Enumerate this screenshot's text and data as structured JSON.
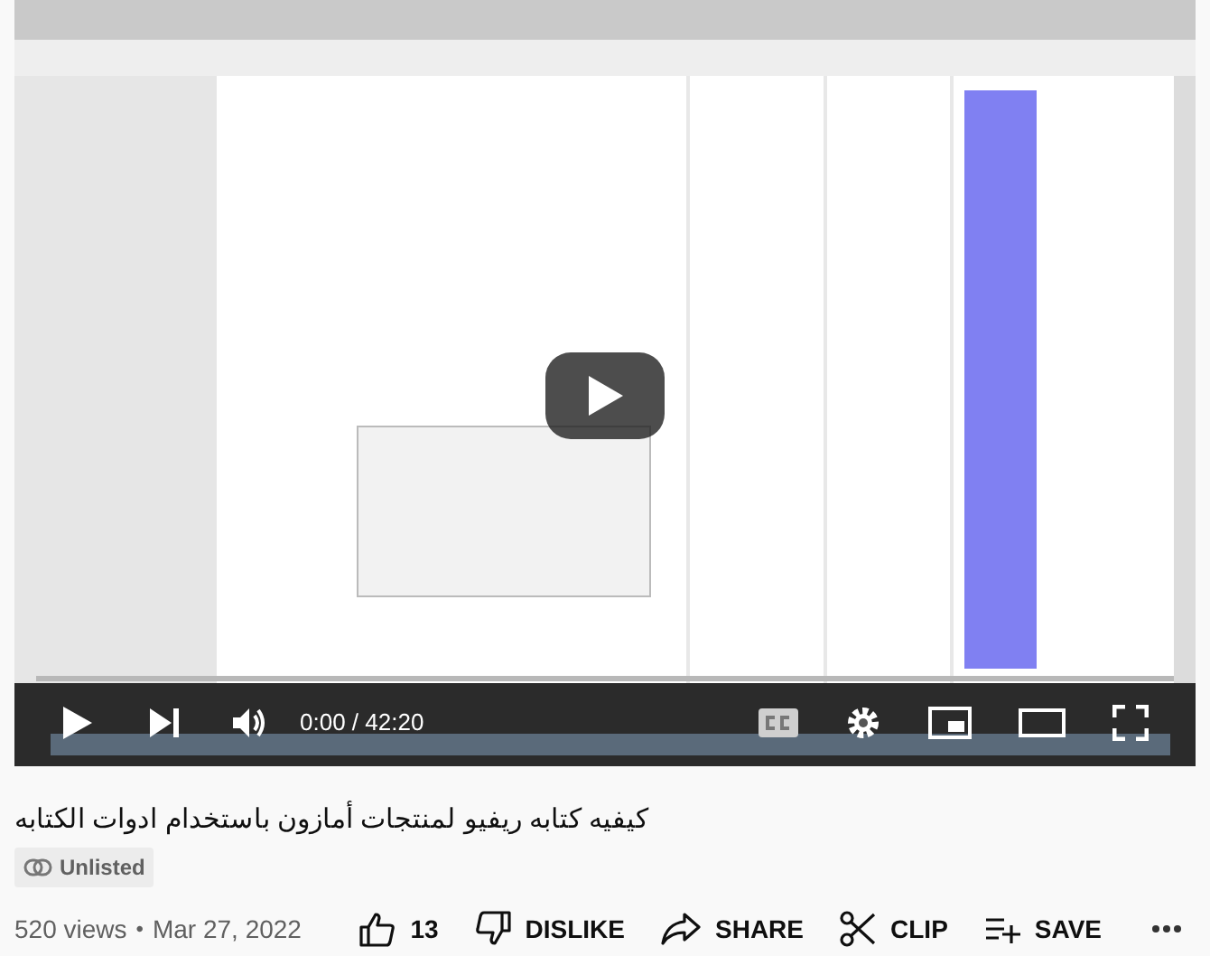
{
  "player": {
    "time": "0:00 / 42:20"
  },
  "video_title": "كيفيه كتابه ريفيو لمنتجات أمازون باستخدام ادوات الكتابه",
  "badge": {
    "label": "Unlisted"
  },
  "views": "520 views",
  "separator": "•",
  "date": "Mar 27, 2022",
  "actions": [
    {
      "kind": "like",
      "label": "13"
    },
    {
      "kind": "dislike",
      "label": "DISLIKE"
    },
    {
      "kind": "share",
      "label": "SHARE"
    },
    {
      "kind": "clip",
      "label": "CLIP"
    },
    {
      "kind": "save",
      "label": "SAVE"
    }
  ]
}
